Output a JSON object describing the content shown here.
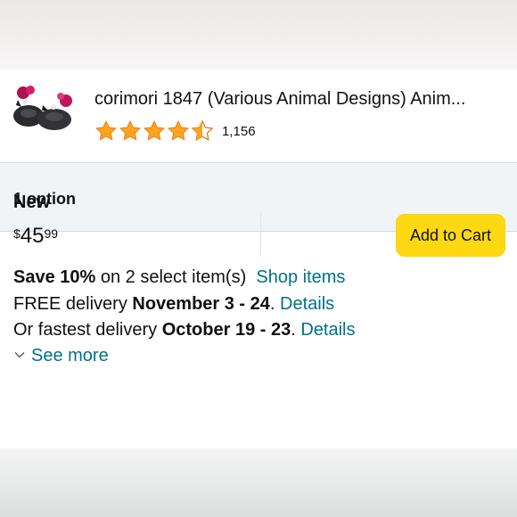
{
  "product": {
    "title": "corimori 1847 (Various Animal Designs) Anim...",
    "rating": 4.5,
    "rating_count": "1,156",
    "star_color": "#ffa41c"
  },
  "options": {
    "label": "1 option"
  },
  "offer": {
    "condition": "New",
    "price": {
      "symbol": "$",
      "whole": "45",
      "fraction": "99"
    },
    "add_to_cart_label": "Add to Cart",
    "button_color": "#ffd814",
    "save": {
      "bold": "Save 10%",
      "text": " on 2 select item(s)",
      "link": "Shop items"
    },
    "delivery": {
      "prefix": "FREE delivery ",
      "dates": "November 3 - 24",
      "suffix": ". ",
      "link": "Details"
    },
    "fastest": {
      "prefix": "Or fastest delivery ",
      "dates": "October 19 - 23",
      "suffix": ". ",
      "link": "Details"
    },
    "see_more": "See more",
    "link_color": "#007185"
  }
}
